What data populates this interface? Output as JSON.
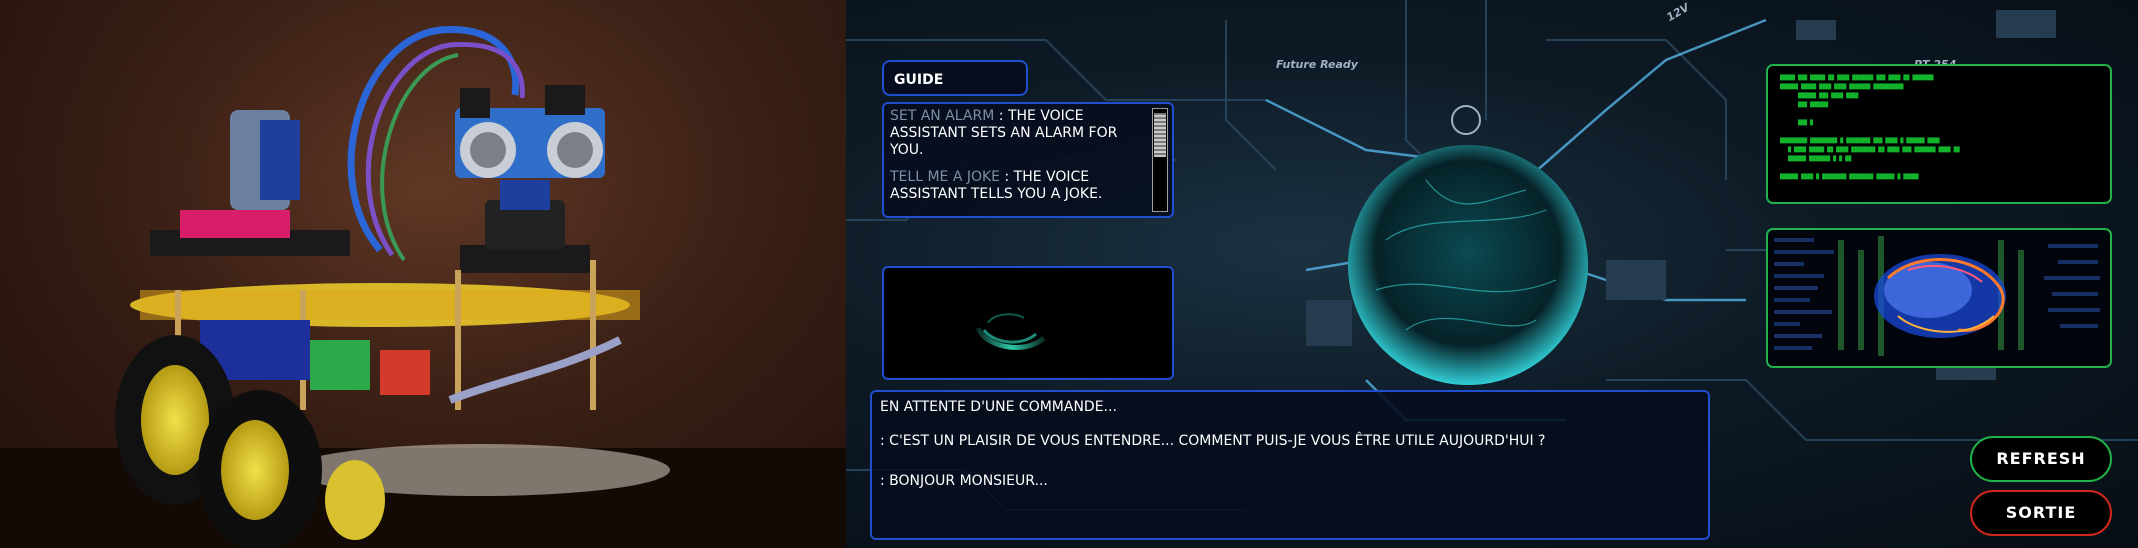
{
  "photo": {
    "description_icon": "robot-car-photo"
  },
  "background_labels": {
    "future_ready": "Future Ready",
    "voltage": "12V",
    "chip": "PT 254"
  },
  "guide": {
    "title": "GUIDE",
    "entries": [
      {
        "key": "SET AN ALARM",
        "sep": " : ",
        "text": "THE VOICE ASSISTANT SETS AN ALARM FOR YOU."
      },
      {
        "key": "TELL ME A JOKE",
        "sep": " : ",
        "text": "THE VOICE ASSISTANT TELLS YOU A JOKE."
      }
    ]
  },
  "log": {
    "lines": [
      "EN ATTENTE D'UNE COMMANDE...",
      ": C'EST UN PLAISIR DE VOUS ENTENDRE... COMMENT PUIS-JE VOUS ÊTRE UTILE AUJOURD'HUI ?",
      ": BONJOUR MONSIEUR..."
    ]
  },
  "buttons": {
    "refresh": "REFRESH",
    "sortie": "SORTIE"
  },
  "colors": {
    "panel_border": "#1f4fd0",
    "terminal_green": "#1fb34a",
    "exit_red": "#d1271c",
    "orb_cyan": "#37d6d6"
  }
}
